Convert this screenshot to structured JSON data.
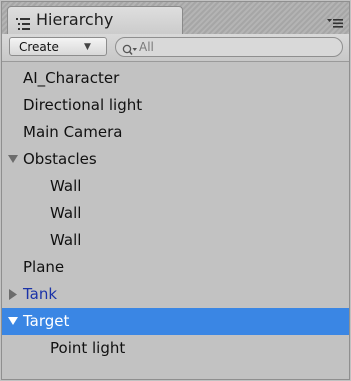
{
  "window": {
    "tab_title": "Hierarchy"
  },
  "icons": {
    "tab": "hierarchy-list-icon",
    "menu": "panel-menu-icon",
    "search": "search-icon",
    "foldout_expanded": "triangle-down-icon",
    "foldout_collapsed": "triangle-right-icon"
  },
  "toolbar": {
    "create_label": "Create",
    "search_placeholder": "All"
  },
  "colors": {
    "selection": "#3a86e4",
    "prefab_text": "#1b33a8",
    "panel_bg": "#c2c2c2"
  },
  "hierarchy": {
    "items": [
      {
        "label": "AI_Character",
        "depth": 0,
        "foldout": "none",
        "selected": false,
        "prefab": false
      },
      {
        "label": "Directional light",
        "depth": 0,
        "foldout": "none",
        "selected": false,
        "prefab": false
      },
      {
        "label": "Main Camera",
        "depth": 0,
        "foldout": "none",
        "selected": false,
        "prefab": false
      },
      {
        "label": "Obstacles",
        "depth": 0,
        "foldout": "expanded",
        "selected": false,
        "prefab": false
      },
      {
        "label": "Wall",
        "depth": 1,
        "foldout": "none",
        "selected": false,
        "prefab": false
      },
      {
        "label": "Wall",
        "depth": 1,
        "foldout": "none",
        "selected": false,
        "prefab": false
      },
      {
        "label": "Wall",
        "depth": 1,
        "foldout": "none",
        "selected": false,
        "prefab": false
      },
      {
        "label": "Plane",
        "depth": 0,
        "foldout": "none",
        "selected": false,
        "prefab": false
      },
      {
        "label": "Tank",
        "depth": 0,
        "foldout": "collapsed",
        "selected": false,
        "prefab": true
      },
      {
        "label": "Target",
        "depth": 0,
        "foldout": "expanded",
        "selected": true,
        "prefab": false
      },
      {
        "label": "Point light",
        "depth": 1,
        "foldout": "none",
        "selected": false,
        "prefab": false
      }
    ]
  }
}
